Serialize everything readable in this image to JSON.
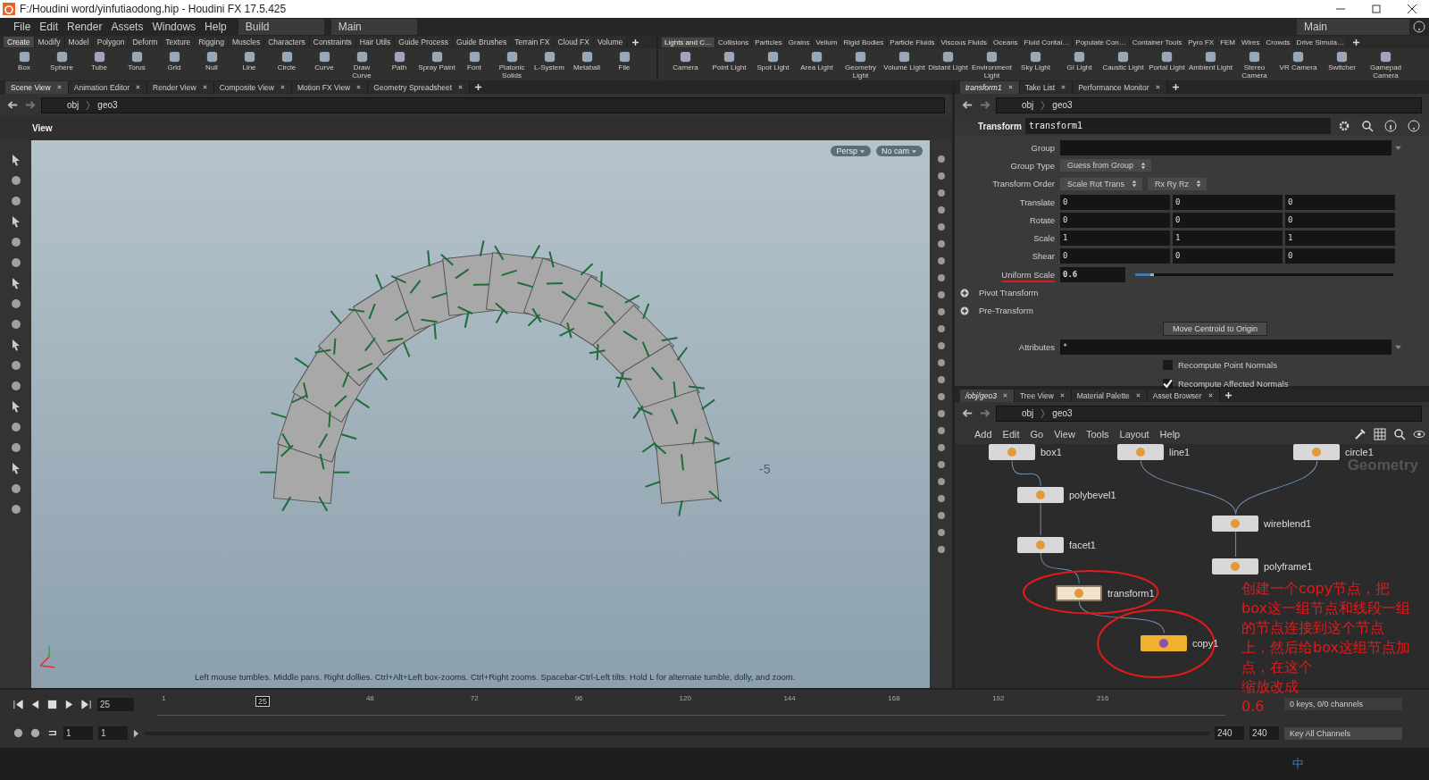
{
  "window": {
    "title": "F:/Houdini word/yinfutiaodong.hip - Houdini FX 17.5.425"
  },
  "menu": [
    "File",
    "Edit",
    "Render",
    "Assets",
    "Windows",
    "Help"
  ],
  "desktop": "Build",
  "context": "Main",
  "right_context": "Main",
  "shelf_left": {
    "tabs": [
      {
        "label": "Create",
        "selected": true
      },
      {
        "label": "Modify",
        "selected": false
      },
      {
        "label": "Model",
        "selected": false
      },
      {
        "label": "Polygon",
        "selected": false
      },
      {
        "label": "Deform",
        "selected": false
      },
      {
        "label": "Texture",
        "selected": false
      },
      {
        "label": "Rigging",
        "selected": false
      },
      {
        "label": "Muscles",
        "selected": false
      },
      {
        "label": "Characters",
        "selected": false
      },
      {
        "label": "Constraints",
        "selected": false
      },
      {
        "label": "Hair Utils",
        "selected": false
      },
      {
        "label": "Guide Process",
        "selected": false
      },
      {
        "label": "Guide Brushes",
        "selected": false
      },
      {
        "label": "Terrain FX",
        "selected": false
      },
      {
        "label": "Cloud FX",
        "selected": false
      },
      {
        "label": "Volume",
        "selected": false
      }
    ],
    "tools": [
      "Box",
      "Sphere",
      "Tube",
      "Torus",
      "Grid",
      "Null",
      "Line",
      "Circle",
      "Curve",
      "Draw Curve",
      "Path",
      "Spray Paint",
      "Font",
      "Platonic Solids",
      "L-System",
      "Metaball",
      "File"
    ]
  },
  "shelf_right": {
    "tabs": [
      {
        "label": "Lights and C…",
        "selected": true
      },
      {
        "label": "Collisions",
        "selected": false
      },
      {
        "label": "Particles",
        "selected": false
      },
      {
        "label": "Grains",
        "selected": false
      },
      {
        "label": "Vellum",
        "selected": false
      },
      {
        "label": "Rigid Bodies",
        "selected": false
      },
      {
        "label": "Particle Fluids",
        "selected": false
      },
      {
        "label": "Viscous Fluids",
        "selected": false
      },
      {
        "label": "Oceans",
        "selected": false
      },
      {
        "label": "Fluid Contai…",
        "selected": false
      },
      {
        "label": "Populate Con…",
        "selected": false
      },
      {
        "label": "Container Tools",
        "selected": false
      },
      {
        "label": "Pyro FX",
        "selected": false
      },
      {
        "label": "FEM",
        "selected": false
      },
      {
        "label": "Wires",
        "selected": false
      },
      {
        "label": "Crowds",
        "selected": false
      },
      {
        "label": "Drive Simula…",
        "selected": false
      }
    ],
    "tools": [
      "Camera",
      "Point Light",
      "Spot Light",
      "Area Light",
      "Geometry Light",
      "Volume Light",
      "Distant Light",
      "Environment Light",
      "Sky Light",
      "GI Light",
      "Caustic Light",
      "Portal Light",
      "Ambient Light",
      "Stereo Camera",
      "VR Camera",
      "Switcher",
      "Gamepad Camera"
    ]
  },
  "scene_pane": {
    "tabs": [
      {
        "label": "Scene View",
        "selected": true
      },
      {
        "label": "Animation Editor",
        "selected": false
      },
      {
        "label": "Render View",
        "selected": false
      },
      {
        "label": "Composite View",
        "selected": false
      },
      {
        "label": "Motion FX View",
        "selected": false
      },
      {
        "label": "Geometry Spreadsheet",
        "selected": false
      }
    ],
    "path": [
      "obj",
      "geo3"
    ],
    "view_label": "View",
    "persp": "Persp",
    "cam": "No cam",
    "grid_label": "-5",
    "status": "Left mouse tumbles. Middle pans. Right dollies. Ctrl+Alt+Left box-zooms. Ctrl+Right zooms. Spacebar-Ctrl-Left tilts. Hold L for alternate tumble, dolly, and zoom."
  },
  "param_pane": {
    "tabs": [
      {
        "label": "transform1",
        "selected": true
      },
      {
        "label": "Take List",
        "selected": false
      },
      {
        "label": "Performance Monitor",
        "selected": false
      }
    ],
    "path": [
      "obj",
      "geo3"
    ],
    "node_type": "Transform",
    "node_name": "transform1",
    "params": [
      {
        "kind": "text",
        "label": "Group"
      },
      {
        "kind": "menu",
        "label": "Group Type",
        "values": [
          "Guess from Group"
        ]
      },
      {
        "kind": "menu",
        "label": "Transform Order",
        "values": [
          "Scale Rot Trans",
          "Rx Ry Rz"
        ]
      },
      {
        "kind": "vector",
        "label": "Translate",
        "values": [
          "0",
          "0",
          "0"
        ]
      },
      {
        "kind": "vector",
        "label": "Rotate",
        "values": [
          "0",
          "0",
          "0"
        ]
      },
      {
        "kind": "vector",
        "label": "Scale",
        "values": [
          "1",
          "1",
          "1"
        ]
      },
      {
        "kind": "vector",
        "label": "Shear",
        "values": [
          "0",
          "0",
          "0"
        ]
      },
      {
        "kind": "slider",
        "label": "Uniform Scale",
        "value": "0.6",
        "level": 0.06
      },
      {
        "kind": "folder",
        "label": "Pivot Transform"
      },
      {
        "kind": "folder",
        "label": "Pre-Transform"
      },
      {
        "kind": "button",
        "label": "Move Centroid to Origin"
      },
      {
        "kind": "text",
        "label": "Attributes",
        "value": "*"
      },
      {
        "kind": "check",
        "label": "Recompute Point Normals",
        "checked": false
      },
      {
        "kind": "check",
        "label": "Recompute Affected Normals",
        "checked": true
      }
    ]
  },
  "network_pane": {
    "tabs": [
      {
        "label": "/obj/geo3",
        "selected": true
      },
      {
        "label": "Tree View",
        "selected": false
      },
      {
        "label": "Material Palette",
        "selected": false
      },
      {
        "label": "Asset Browser",
        "selected": false
      }
    ],
    "path": [
      "obj",
      "geo3"
    ],
    "menu": [
      "Add",
      "Edit",
      "Go",
      "View",
      "Tools",
      "Layout",
      "Help"
    ],
    "context_label": "Geometry",
    "nodes": [
      {
        "name": "box1"
      },
      {
        "name": "line1"
      },
      {
        "name": "circle1"
      },
      {
        "name": "polybevel1"
      },
      {
        "name": "wireblend1"
      },
      {
        "name": "facet1"
      },
      {
        "name": "polyframe1"
      },
      {
        "name": "transform1",
        "selected": true
      },
      {
        "name": "copy1",
        "selected": false
      }
    ],
    "annotation": [
      "创建一个copy节点，把",
      "box这一组节点和线段一组",
      "的节点连接到这个节点",
      "上，然后给box这组节点加",
      "点，在这个",
      "缩放改成",
      "0.6"
    ]
  },
  "timeline": {
    "frame": "25",
    "marker": "25",
    "ticks": [
      "1",
      "48",
      "72",
      "96",
      "120",
      "144",
      "168",
      "192",
      "216"
    ],
    "start": "1",
    "range_start": "1",
    "range_end": "240",
    "end": "240",
    "keys": "0 keys, 0/0 channels",
    "key_mode": "Key All Channels"
  },
  "tray": {
    "ime": "中"
  }
}
